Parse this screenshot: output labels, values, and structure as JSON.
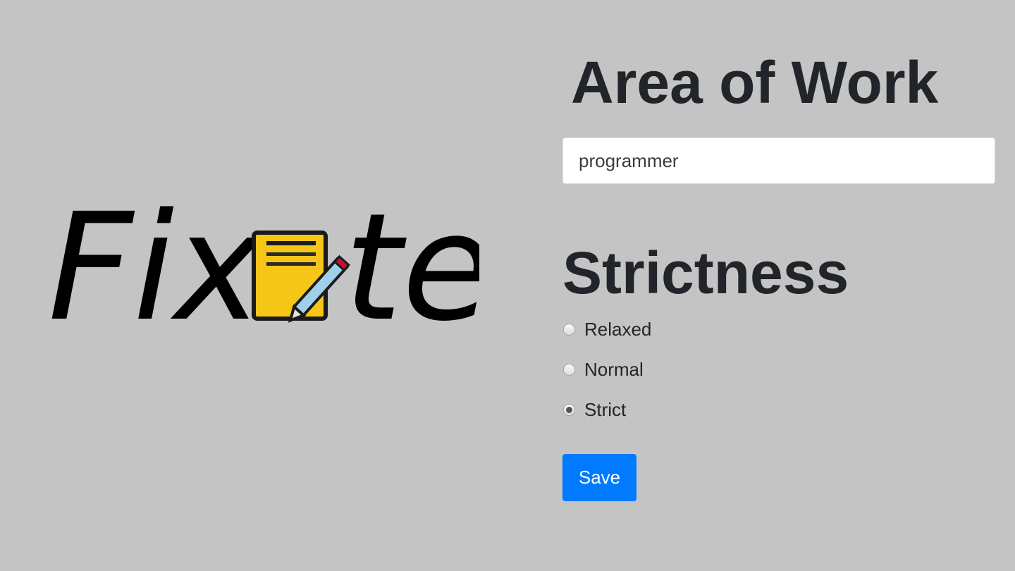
{
  "logo": {
    "text_before": "Fix",
    "text_after": "te",
    "notepad_color": "#f5c518",
    "icon": "notepad-pencil-icon"
  },
  "area_of_work": {
    "heading": "Area of Work",
    "value": "programmer"
  },
  "strictness": {
    "heading": "Strictness",
    "options": [
      {
        "label": "Relaxed",
        "checked": false
      },
      {
        "label": "Normal",
        "checked": false
      },
      {
        "label": "Strict",
        "checked": true
      }
    ]
  },
  "save_button": {
    "label": "Save",
    "color": "#007bff"
  }
}
